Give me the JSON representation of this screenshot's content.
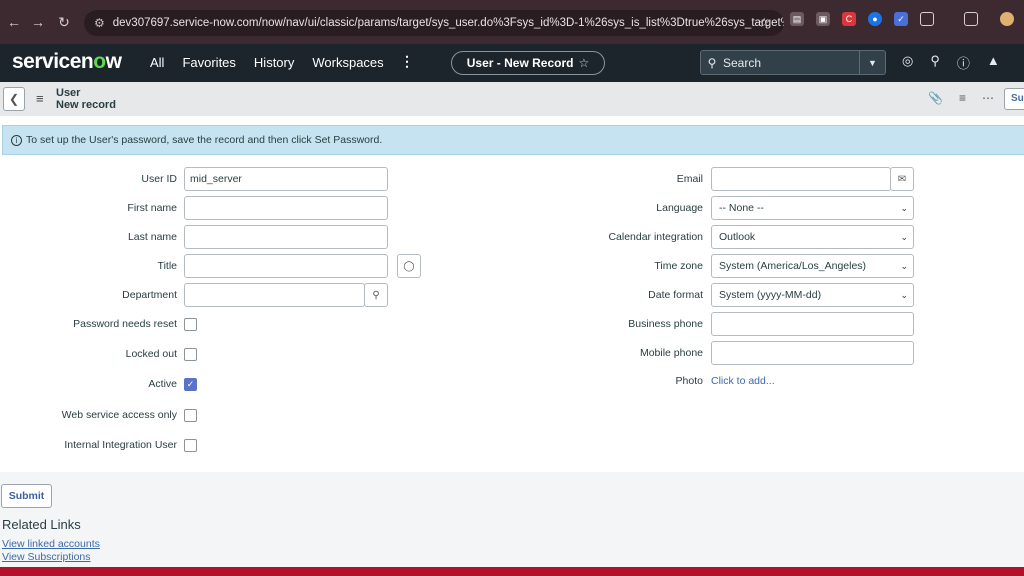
{
  "browser": {
    "url": "dev307697.service-now.com/now/nav/ui/classic/params/target/sys_user.do%3Fsys_id%3D-1%26sys_is_list%3Dtrue%26sys_target%3D..."
  },
  "header": {
    "logo_part1": "servicen",
    "logo_o": "o",
    "logo_part2": "w",
    "menu": [
      "All",
      "Favorites",
      "History",
      "Workspaces"
    ],
    "record_pill": "User - New Record",
    "search_label": "Search"
  },
  "form_header": {
    "table": "User",
    "subtitle": "New record",
    "submit_label": "Submit"
  },
  "banner": {
    "text": "To set up the User's password, save the record and then click Set Password."
  },
  "left_fields": {
    "user_id": {
      "label": "User ID",
      "value": "mid_server"
    },
    "first_name": {
      "label": "First name",
      "value": ""
    },
    "last_name": {
      "label": "Last name",
      "value": ""
    },
    "title": {
      "label": "Title",
      "value": ""
    },
    "department": {
      "label": "Department",
      "value": ""
    },
    "password_reset": {
      "label": "Password needs reset",
      "checked": false
    },
    "locked_out": {
      "label": "Locked out",
      "checked": false
    },
    "active": {
      "label": "Active",
      "checked": true
    },
    "web_service": {
      "label": "Web service access only",
      "checked": false
    },
    "internal_integration": {
      "label": "Internal Integration User",
      "checked": false
    }
  },
  "right_fields": {
    "email": {
      "label": "Email",
      "value": ""
    },
    "language": {
      "label": "Language",
      "value": "-- None --"
    },
    "calendar": {
      "label": "Calendar integration",
      "value": "Outlook"
    },
    "timezone": {
      "label": "Time zone",
      "value": "System (America/Los_Angeles)"
    },
    "date_format": {
      "label": "Date format",
      "value": "System (yyyy-MM-dd)"
    },
    "business_phone": {
      "label": "Business phone",
      "value": ""
    },
    "mobile_phone": {
      "label": "Mobile phone",
      "value": ""
    },
    "photo": {
      "label": "Photo",
      "link": "Click to add..."
    }
  },
  "footer": {
    "submit_label": "Submit",
    "related_links_title": "Related Links",
    "links": [
      "View linked accounts",
      "View Subscriptions"
    ]
  },
  "colors": {
    "header_bg": "#1c252c",
    "banner_bg": "#c5e3f0",
    "accent_link": "#3c6aa8",
    "brand_green": "#62d84e",
    "bottom_strip": "#b3112b"
  }
}
